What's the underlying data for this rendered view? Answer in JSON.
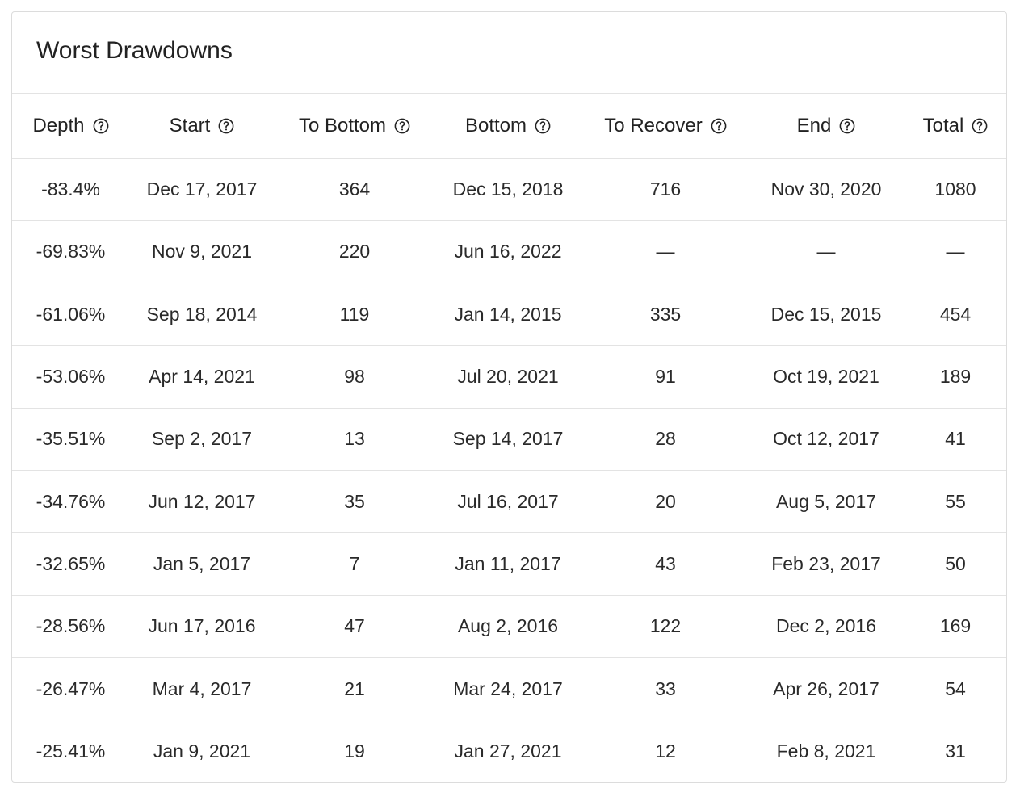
{
  "card": {
    "title": "Worst Drawdowns"
  },
  "table": {
    "headers": [
      {
        "label": "Depth",
        "icon": "help-circle-icon"
      },
      {
        "label": "Start",
        "icon": "help-circle-icon"
      },
      {
        "label": "To Bottom",
        "icon": "help-circle-icon"
      },
      {
        "label": "Bottom",
        "icon": "help-circle-icon"
      },
      {
        "label": "To Recover",
        "icon": "help-circle-icon"
      },
      {
        "label": "End",
        "icon": "help-circle-icon"
      },
      {
        "label": "Total",
        "icon": "help-circle-icon"
      }
    ],
    "rows": [
      {
        "depth": "-83.4%",
        "start": "Dec 17, 2017",
        "to_bottom": "364",
        "bottom": "Dec 15, 2018",
        "to_recover": "716",
        "end": "Nov 30, 2020",
        "total": "1080"
      },
      {
        "depth": "-69.83%",
        "start": "Nov 9, 2021",
        "to_bottom": "220",
        "bottom": "Jun 16, 2022",
        "to_recover": "—",
        "end": "—",
        "total": "—"
      },
      {
        "depth": "-61.06%",
        "start": "Sep 18, 2014",
        "to_bottom": "119",
        "bottom": "Jan 14, 2015",
        "to_recover": "335",
        "end": "Dec 15, 2015",
        "total": "454"
      },
      {
        "depth": "-53.06%",
        "start": "Apr 14, 2021",
        "to_bottom": "98",
        "bottom": "Jul 20, 2021",
        "to_recover": "91",
        "end": "Oct 19, 2021",
        "total": "189"
      },
      {
        "depth": "-35.51%",
        "start": "Sep 2, 2017",
        "to_bottom": "13",
        "bottom": "Sep 14, 2017",
        "to_recover": "28",
        "end": "Oct 12, 2017",
        "total": "41"
      },
      {
        "depth": "-34.76%",
        "start": "Jun 12, 2017",
        "to_bottom": "35",
        "bottom": "Jul 16, 2017",
        "to_recover": "20",
        "end": "Aug 5, 2017",
        "total": "55"
      },
      {
        "depth": "-32.65%",
        "start": "Jan 5, 2017",
        "to_bottom": "7",
        "bottom": "Jan 11, 2017",
        "to_recover": "43",
        "end": "Feb 23, 2017",
        "total": "50"
      },
      {
        "depth": "-28.56%",
        "start": "Jun 17, 2016",
        "to_bottom": "47",
        "bottom": "Aug 2, 2016",
        "to_recover": "122",
        "end": "Dec 2, 2016",
        "total": "169"
      },
      {
        "depth": "-26.47%",
        "start": "Mar 4, 2017",
        "to_bottom": "21",
        "bottom": "Mar 24, 2017",
        "to_recover": "33",
        "end": "Apr 26, 2017",
        "total": "54"
      },
      {
        "depth": "-25.41%",
        "start": "Jan 9, 2021",
        "to_bottom": "19",
        "bottom": "Jan 27, 2021",
        "to_recover": "12",
        "end": "Feb 8, 2021",
        "total": "31"
      }
    ]
  }
}
